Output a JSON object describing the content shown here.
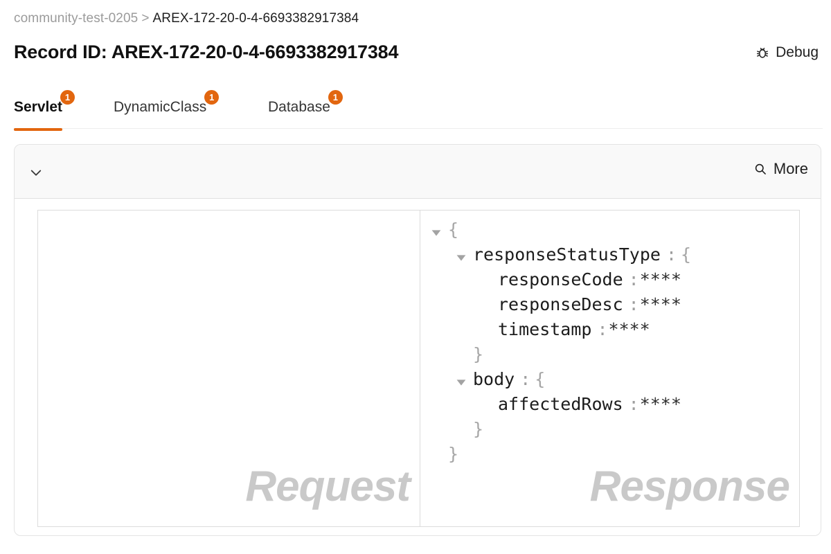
{
  "breadcrumb": {
    "parent": "community-test-0205",
    "separator": ">",
    "current": "AREX-172-20-0-4-6693382917384"
  },
  "header": {
    "title": "Record ID: AREX-172-20-0-4-6693382917384",
    "debug_label": "Debug",
    "debug_icon": "bug-icon"
  },
  "tabs": [
    {
      "label": "Servlet",
      "badge": "1",
      "active": true
    },
    {
      "label": "DynamicClass",
      "badge": "1",
      "active": false
    },
    {
      "label": "Database",
      "badge": "1",
      "active": false
    }
  ],
  "card": {
    "collapse_icon": "chevron-down-icon",
    "more_label": "More",
    "more_icon": "search-icon"
  },
  "panes": {
    "request": {
      "watermark": "Request",
      "content": ""
    },
    "response": {
      "watermark": "Response",
      "tree": [
        {
          "indent": 0,
          "caret": "down",
          "key": "",
          "colon": "",
          "value": "{",
          "kind": "open"
        },
        {
          "indent": 1,
          "caret": "down",
          "key": "responseStatusType",
          "colon": ":",
          "value": "{",
          "kind": "open"
        },
        {
          "indent": 2,
          "caret": "none",
          "key": "responseCode",
          "colon": ":",
          "value": "****",
          "kind": "leaf"
        },
        {
          "indent": 2,
          "caret": "none",
          "key": "responseDesc",
          "colon": ":",
          "value": "****",
          "kind": "leaf"
        },
        {
          "indent": 2,
          "caret": "none",
          "key": "timestamp",
          "colon": ":",
          "value": "****",
          "kind": "leaf"
        },
        {
          "indent": 1,
          "caret": "none",
          "key": "",
          "colon": "",
          "value": "}",
          "kind": "close"
        },
        {
          "indent": 1,
          "caret": "down",
          "key": "body",
          "colon": ":",
          "value": "{",
          "kind": "open"
        },
        {
          "indent": 2,
          "caret": "none",
          "key": "affectedRows",
          "colon": ":",
          "value": "****",
          "kind": "leaf"
        },
        {
          "indent": 1,
          "caret": "none",
          "key": "",
          "colon": "",
          "value": "}",
          "kind": "close"
        },
        {
          "indent": 0,
          "caret": "none",
          "key": "",
          "colon": "",
          "value": "}",
          "kind": "close"
        }
      ]
    }
  },
  "colors": {
    "accent": "#e2660f",
    "badge_bg": "#e2660f",
    "watermark": "#c9c9c9",
    "card_border": "#e3e3e3",
    "header_bg": "#f9f9f9"
  }
}
